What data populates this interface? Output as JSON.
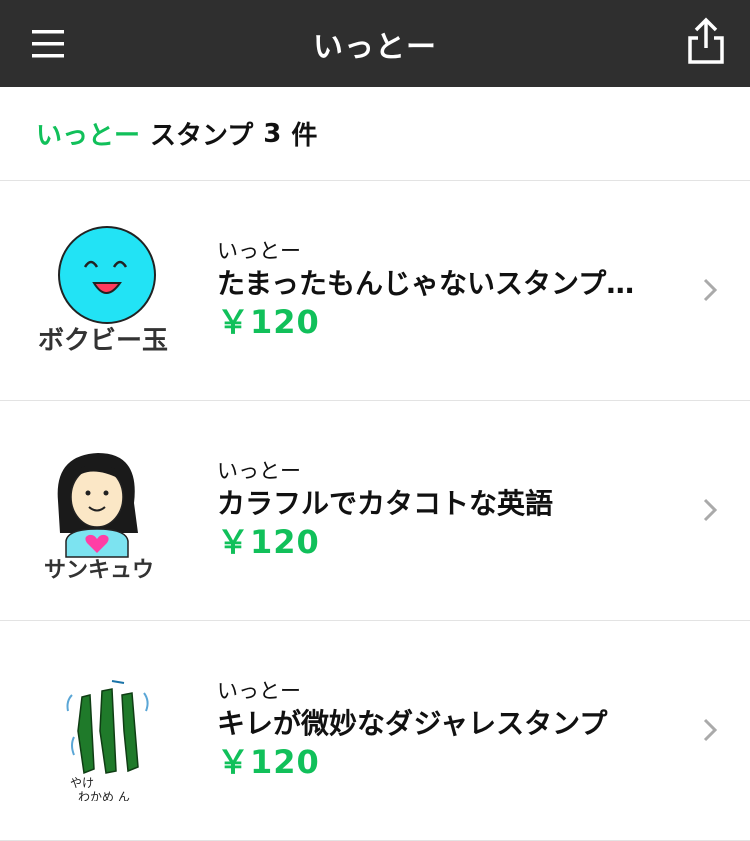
{
  "header": {
    "title": "いっとー",
    "menu_icon": "hamburger-menu-icon",
    "share_icon": "share-icon"
  },
  "summary": {
    "author": "いっとー",
    "label": "スタンプ",
    "count": "3",
    "unit": "件"
  },
  "items": [
    {
      "author": "いっとー",
      "title": "たまったもんじゃないスタンプ…",
      "price": "￥120",
      "thumb_text": "ボクビー玉",
      "chevron_icon": "chevron-right-icon"
    },
    {
      "author": "いっとー",
      "title": "カラフルでカタコトな英語",
      "price": "￥120",
      "thumb_text": "サンキュウ",
      "chevron_icon": "chevron-right-icon"
    },
    {
      "author": "いっとー",
      "title": "キレが微妙なダジャレスタンプ",
      "price": "￥120",
      "thumb_text_1": "やけ",
      "thumb_text_2": "わかめ ん",
      "chevron_icon": "chevron-right-icon"
    }
  ],
  "colors": {
    "header_bg": "#2f2f2f",
    "accent_green": "#11c05a",
    "divider": "#e3e3e3"
  }
}
